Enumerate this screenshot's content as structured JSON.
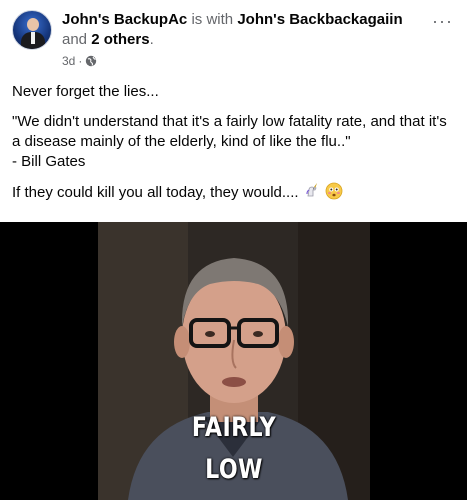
{
  "post": {
    "author": "John's BackupAc",
    "with_text": "is with",
    "tagged_person": "John's Backbackagaiin",
    "and_text": "and",
    "others": "2 others",
    "period": ".",
    "timestamp": "3d",
    "separator": "·",
    "privacy_icon": "globe-icon",
    "more_label": "···",
    "lines": [
      "Never forget the lies...",
      "\"We didn't understand that it's a fairly low fatality rate, and that it's a disease mainly of the elderly, kind of like the flu..\"",
      "- Bill Gates",
      "If they could kill you all today, they would...."
    ],
    "emojis": [
      "unicorn-emoji",
      "flushed-face-emoji"
    ]
  },
  "video": {
    "caption_line1": "FAIRLY",
    "caption_line2": "LOW"
  },
  "colors": {
    "text": "#050505",
    "muted": "#65676b",
    "video_bg": "#000000"
  }
}
